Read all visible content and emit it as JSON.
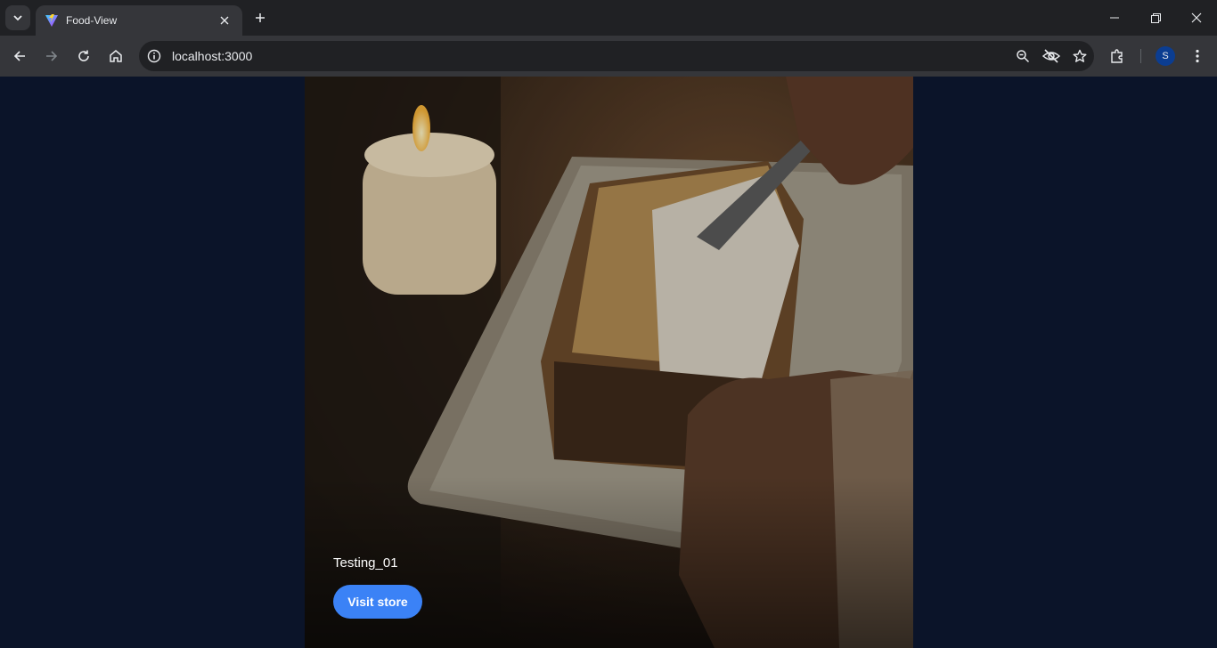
{
  "browser": {
    "tab_title": "Food-View",
    "url": "localhost:3000",
    "profile_initial": "S"
  },
  "video_card": {
    "title": "Testing_01",
    "button_label": "Visit store"
  },
  "colors": {
    "page_bg": "#0b1429",
    "button_bg": "#3b82f6",
    "chrome_dark": "#202124",
    "chrome_toolbar": "#35363a"
  },
  "icons": [
    "tab-search-icon",
    "vite-logo-icon",
    "close-icon",
    "plus-icon",
    "minimize-icon",
    "restore-icon",
    "window-close-icon",
    "back-icon",
    "forward-icon",
    "reload-icon",
    "home-icon",
    "site-info-icon",
    "zoom-icon",
    "eye-off-icon",
    "star-icon",
    "extensions-icon",
    "more-icon"
  ]
}
